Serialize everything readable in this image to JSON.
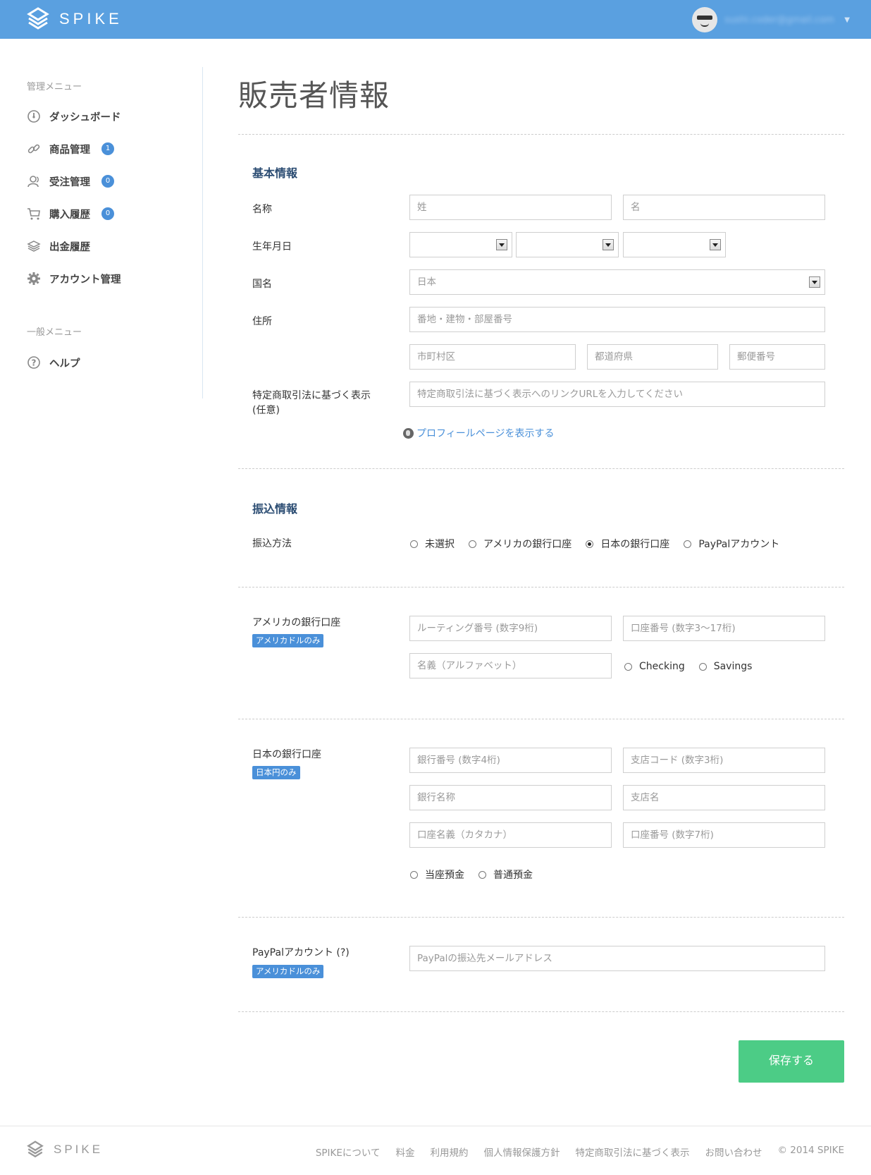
{
  "header": {
    "brand": "SPIKE",
    "user_email": "sushi.coder@gmail.com"
  },
  "sidebar": {
    "admin_heading": "管理メニュー",
    "items": [
      {
        "label": "ダッシュボード",
        "icon": "dashboard-icon"
      },
      {
        "label": "商品管理",
        "icon": "link-icon",
        "badge": "1"
      },
      {
        "label": "受注管理",
        "icon": "users-icon",
        "badge": "0"
      },
      {
        "label": "購入履歴",
        "icon": "cart-icon",
        "badge": "0"
      },
      {
        "label": "出金履歴",
        "icon": "layers-icon"
      },
      {
        "label": "アカウント管理",
        "icon": "gear-icon"
      }
    ],
    "general_heading": "一般メニュー",
    "help_label": "ヘルプ"
  },
  "page": {
    "title": "販売者情報"
  },
  "basic": {
    "title": "基本情報",
    "name_label": "名称",
    "last_name_placeholder": "姓",
    "first_name_placeholder": "名",
    "birth_label": "生年月日",
    "country_label": "国名",
    "country_value": "日本",
    "address_label": "住所",
    "address_placeholder": "番地・建物・部屋番号",
    "city_placeholder": "市町村区",
    "prefecture_placeholder": "都道府県",
    "zip_placeholder": "郵便番号",
    "legal_label_1": "特定商取引法に基づく表示",
    "legal_label_2": "(任意)",
    "legal_placeholder": "特定商取引法に基づく表示へのリンクURLを入力してください",
    "profile_link": "プロフィールページを表示する"
  },
  "transfer": {
    "title": "振込情報",
    "method_label": "振込方法",
    "options": [
      "未選択",
      "アメリカの銀行口座",
      "日本の銀行口座",
      "PayPalアカウント"
    ],
    "selected": "日本の銀行口座"
  },
  "us_bank": {
    "label": "アメリカの銀行口座",
    "tag": "アメリカドルのみ",
    "routing_placeholder": "ルーティング番号 (数字9桁)",
    "account_placeholder": "口座番号 (数字3〜17桁)",
    "name_placeholder": "名義（アルファベット）",
    "checking": "Checking",
    "savings": "Savings"
  },
  "jp_bank": {
    "label": "日本の銀行口座",
    "tag": "日本円のみ",
    "bank_code_placeholder": "銀行番号 (数字4桁)",
    "branch_code_placeholder": "支店コード (数字3桁)",
    "bank_name_placeholder": "銀行名称",
    "branch_name_placeholder": "支店名",
    "holder_placeholder": "口座名義（カタカナ）",
    "account_placeholder": "口座番号 (数字7桁)",
    "current": "当座預金",
    "ordinary": "普通預金"
  },
  "paypal": {
    "label": "PayPalアカウント (?)",
    "tag": "アメリカドルのみ",
    "email_placeholder": "PayPalの振込先メールアドレス"
  },
  "actions": {
    "save": "保存する"
  },
  "footer": {
    "brand": "SPIKE",
    "links": [
      "SPIKEについて",
      "料金",
      "利用規約",
      "個人情報保護方針",
      "特定商取引法に基づく表示",
      "お問い合わせ"
    ],
    "copyright": "© 2014 SPIKE"
  },
  "colors": {
    "header_bg": "#5aa0e0",
    "accent": "#4a90d9",
    "save_button": "#4ccc86",
    "section_title": "#2c4d73"
  }
}
